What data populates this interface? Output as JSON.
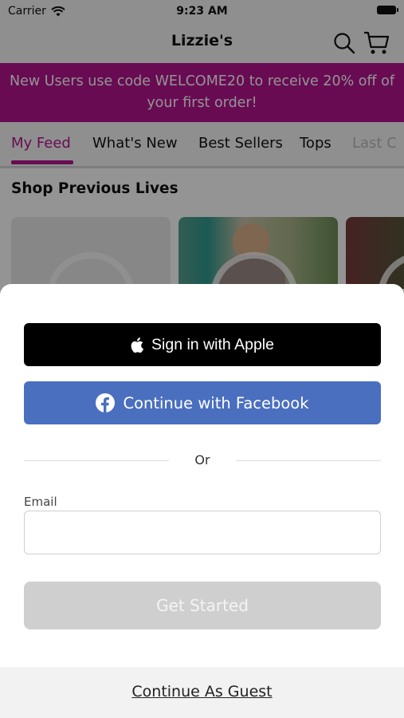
{
  "status_bar": {
    "carrier": "Carrier",
    "time": "9:23 AM"
  },
  "header": {
    "title": "Lizzie's",
    "search_icon": "search-icon",
    "cart_icon": "cart-icon"
  },
  "promo": {
    "text": "New Users use code WELCOME20 to receive 20% off of your first order!",
    "color": "#b3138f"
  },
  "tabs": [
    {
      "label": "My Feed",
      "active": true
    },
    {
      "label": "What's New",
      "active": false
    },
    {
      "label": "Best Sellers",
      "active": false
    },
    {
      "label": "Tops",
      "active": false
    },
    {
      "label": "Last C",
      "active": false
    }
  ],
  "section": {
    "title": "Shop Previous Lives"
  },
  "sheet": {
    "apple_button": "Sign in with Apple",
    "facebook_button": "Continue with Facebook",
    "divider_text": "Or",
    "email_label": "Email",
    "email_value": "",
    "get_started_button": "Get Started",
    "guest_link": "Continue As Guest"
  },
  "colors": {
    "accent": "#b3138f",
    "facebook": "#4a6fbf",
    "apple": "#000000",
    "disabled": "#cfcfcf"
  }
}
